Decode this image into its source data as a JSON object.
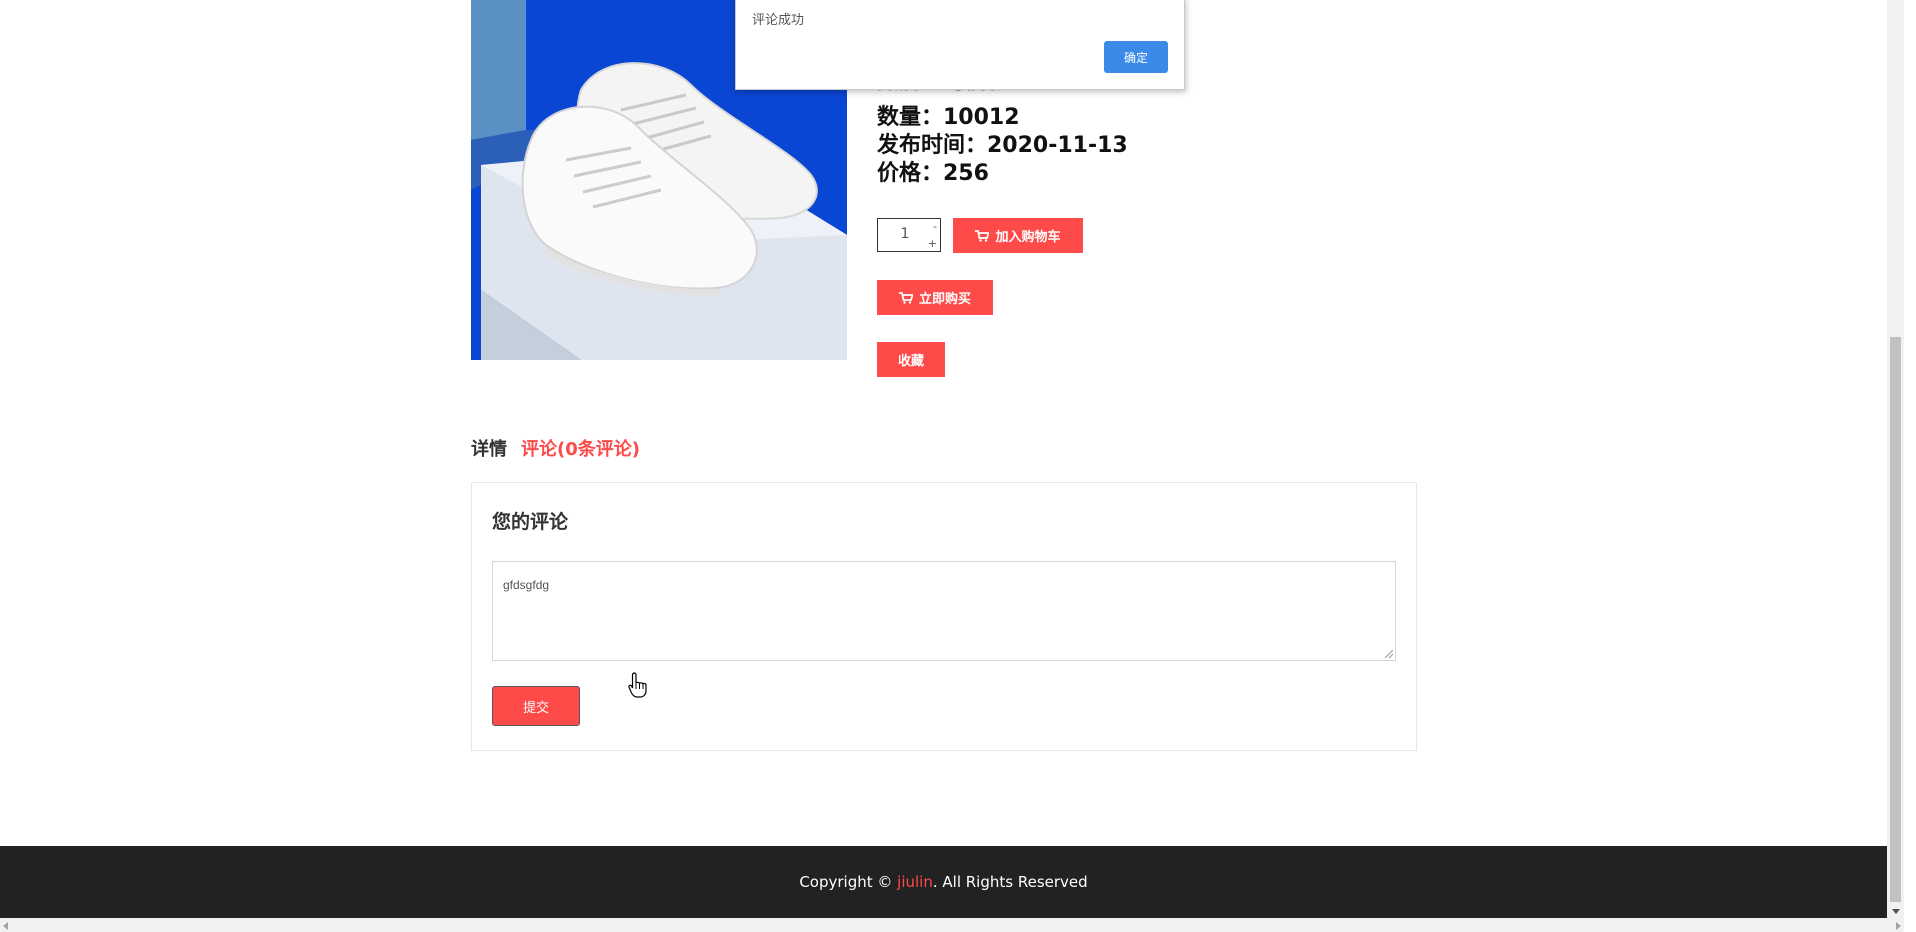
{
  "dialog": {
    "message": "评论成功",
    "ok_label": "确定"
  },
  "product": {
    "brand_line": "品牌：马偶极",
    "quantity_line": "数量：10012",
    "date_line": "发布时间：2020-11-13",
    "price_line": "价格：256"
  },
  "purchase": {
    "qty_value": "1",
    "qty_minus": "-",
    "qty_plus": "+",
    "add_to_cart_label": "加入购物车",
    "buy_now_label": "立即购买",
    "favorite_label": "收藏"
  },
  "tabs": {
    "detail_label": "详情",
    "comment_label": "评论(0条评论)"
  },
  "comment": {
    "title": "您的评论",
    "text_value": "gfdsgfdg",
    "submit_label": "提交"
  },
  "footer": {
    "prefix": "Copyright © ",
    "brand": "jiulin",
    "suffix": ". All Rights Reserved"
  },
  "colors": {
    "accent_red": "#ff4a4a",
    "dialog_button_blue": "#3b8ae8",
    "footer_bg": "#222222"
  },
  "icons": [
    "cart-icon",
    "hand-cursor-icon"
  ]
}
